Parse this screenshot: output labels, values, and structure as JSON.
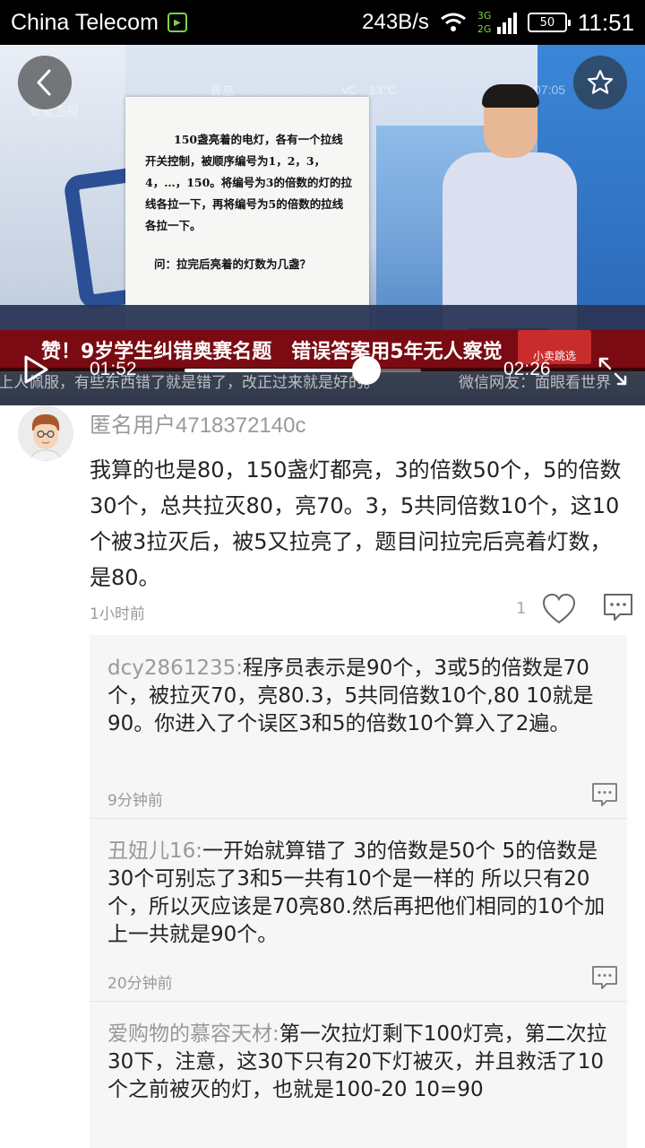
{
  "status_bar": {
    "carrier": "China Telecom",
    "app_badge_icon": "iqiyi-icon",
    "net_speed": "243B/s",
    "network_tags": [
      "3G",
      "2G"
    ],
    "battery": "50",
    "time": "11:51"
  },
  "video": {
    "channel_logo": "安徽卫视",
    "overlay_city": "青岛",
    "overlay_weather": "vC - 13°C",
    "overlay_time": "07:05",
    "paper_problem": "150盏亮着的电灯，各有一个拉线开关控制，被顺序编号为1，2，3，4，…，150。将编号为3的倍数的灯的拉线各拉一下，再将编号为5的倍数的拉线各拉一下。",
    "paper_question": "问：拉完后亮着的灯数为几盏？",
    "headline": "赞！9岁学生纠错奥赛名题　错误答案用5年无人察觉",
    "corner_tag": "小卖跳选",
    "ticker_left": "上人佩服，有些东西错了就是错了，改正过来就是好的。",
    "ticker_right": "微信网友：面眼看世界",
    "current_time": "01:52",
    "total_time": "02:26",
    "progress": 0.77
  },
  "comment": {
    "author": "匿名用户4718372140c",
    "text": "我算的也是80，150盏灯都亮，3的倍数50个，5的倍数30个，总共拉灭80，亮70。3，5共同倍数10个，这10个被3拉灭后，被5又拉亮了，题目问拉完后亮着灯数，是80。",
    "time": "1小时前",
    "likes": "1"
  },
  "replies": [
    {
      "name": "dcy2861235:",
      "text": "程序员表示是90个，3或5的倍数是70个，被拉灭70，亮80.3，5共同倍数10个,80 10就是90。你进入了个误区3和5的倍数10个算入了2遍。",
      "time": "9分钟前"
    },
    {
      "name": "丑妞儿16:",
      "text": "一开始就算错了 3的倍数是50个 5的倍数是30个可别忘了3和5一共有10个是一样的 所以只有20个，所以灭应该是70亮80.然后再把他们相同的10个加上一共就是90个。",
      "time": "20分钟前"
    },
    {
      "name": "爱购物的慕容天材:",
      "text": "第一次拉灯剩下100灯亮，第二次拉30下，注意，这30下只有20下灯被灭，并且救活了10个之前被灭的灯，也就是100-20 10=90",
      "time": ""
    }
  ]
}
